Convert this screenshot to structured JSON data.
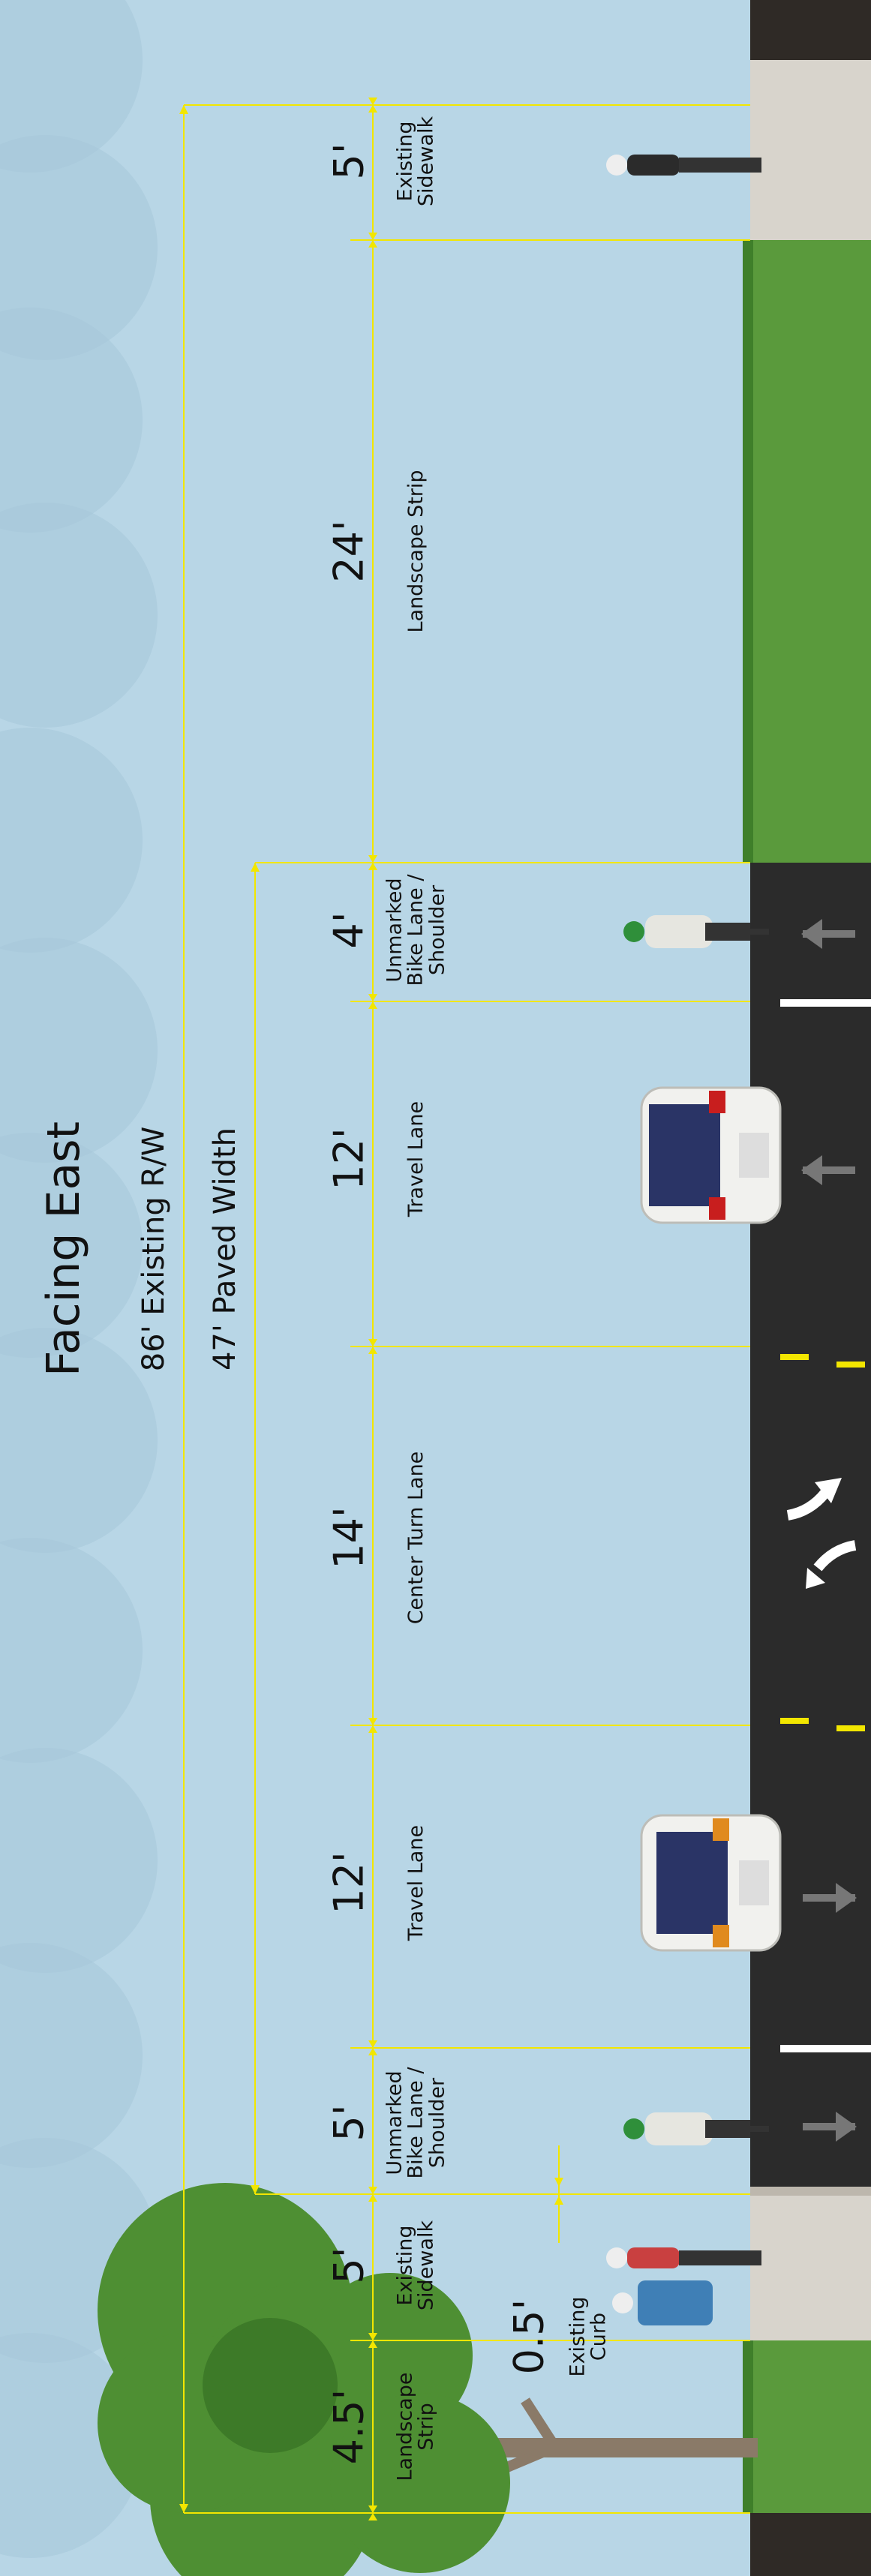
{
  "title": "Facing East",
  "row_width": "86' Existing R/W",
  "paved_width": "47' Paved Width",
  "segments": [
    {
      "dim": "5'",
      "label": [
        "Existing",
        "Sidewalk"
      ]
    },
    {
      "dim": "24'",
      "label": [
        "Landscape Strip"
      ]
    },
    {
      "dim": "4'",
      "label": [
        "Unmarked",
        "Bike Lane /",
        "Shoulder"
      ]
    },
    {
      "dim": "12'",
      "label": [
        "Travel Lane"
      ]
    },
    {
      "dim": "14'",
      "label": [
        "Center Turn Lane"
      ]
    },
    {
      "dim": "12'",
      "label": [
        "Travel Lane"
      ]
    },
    {
      "dim": "5'",
      "label": [
        "Unmarked",
        "Bike Lane /",
        "Shoulder"
      ]
    },
    {
      "dim": "5'",
      "label": [
        "Existing",
        "Sidewalk"
      ]
    },
    {
      "dim": "4.5'",
      "label": [
        "Landscape",
        "Strip"
      ]
    }
  ],
  "curb": {
    "dim": "0.5'",
    "label": [
      "Existing",
      "Curb"
    ]
  },
  "colors": {
    "sky": "#b8d6e6",
    "cloud": "#a6c8db",
    "asphalt": "#2b2b2b",
    "grass": "#5a9a3c",
    "concrete": "#d8d4cc",
    "dimension_line": "#f2e600",
    "lane_line_white": "#ffffff",
    "lane_line_yellow": "#f2e600",
    "tree": "#4e8f33"
  },
  "icons": [
    "tree-icon",
    "pedestrian-icon",
    "cyclist-icon",
    "car-icon",
    "lane-arrow-icon",
    "turn-arrows-icon"
  ]
}
